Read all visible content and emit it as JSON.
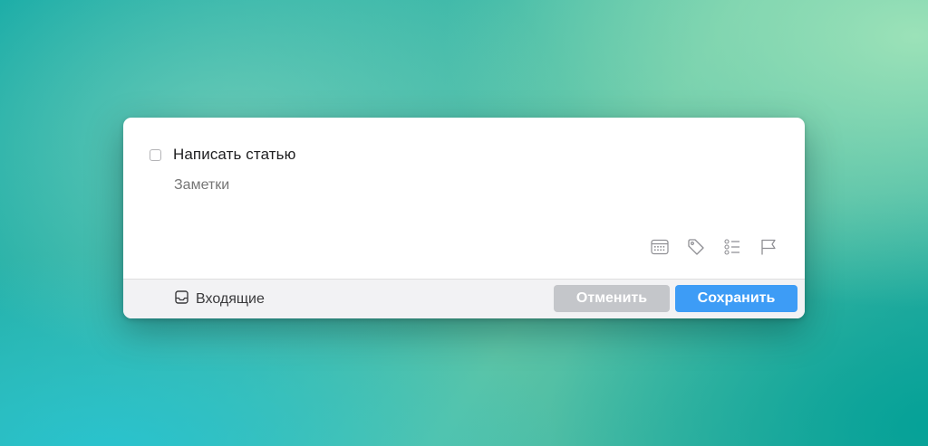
{
  "task": {
    "title": "Написать статью",
    "notes_placeholder": "Заметки"
  },
  "toolbar": {
    "icons": [
      "calendar-icon",
      "tag-icon",
      "checklist-icon",
      "flag-icon"
    ]
  },
  "footer": {
    "list_name": "Входящие",
    "list_icon": "inbox-icon",
    "cancel_label": "Отменить",
    "save_label": "Сохранить"
  },
  "colors": {
    "save_button": "#3d9cf6",
    "cancel_button": "#c4c6ca",
    "footer_bg": "#f2f2f4"
  }
}
